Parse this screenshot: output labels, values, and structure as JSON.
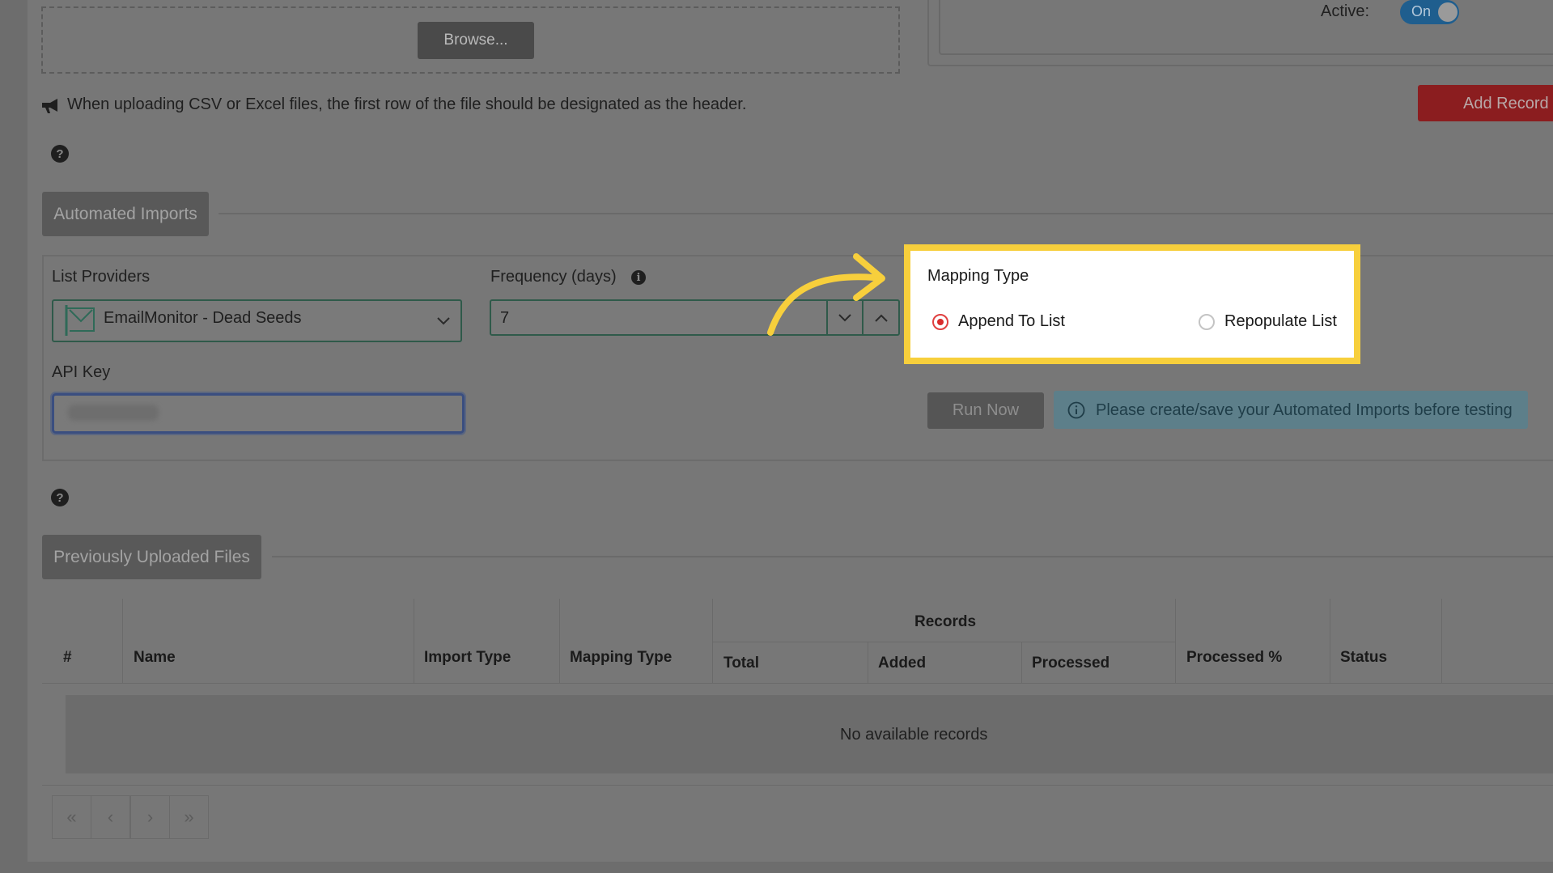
{
  "upload": {
    "browse_label": "Browse...",
    "notice": "When uploading CSV or Excel files, the first row of the file should be designated as the header."
  },
  "header": {
    "active_label": "Active:",
    "toggle_label": "On",
    "add_record_label": "Add Record"
  },
  "automated_imports": {
    "section_label": "Automated Imports",
    "list_providers_label": "List Providers",
    "list_provider_value": "EmailMonitor - Dead Seeds",
    "frequency_label": "Frequency (days)",
    "frequency_value": "7",
    "api_key_label": "API Key",
    "mapping_type_label": "Mapping Type",
    "mapping_options": [
      {
        "label": "Append To List",
        "selected": true
      },
      {
        "label": "Repopulate List",
        "selected": false
      }
    ],
    "run_now_label": "Run Now",
    "test_notice": "Please create/save your Automated Imports before testing"
  },
  "uploaded_files": {
    "section_label": "Previously Uploaded Files",
    "columns": {
      "num": "#",
      "name": "Name",
      "import_type": "Import Type",
      "mapping_type": "Mapping Type",
      "records": "Records",
      "total": "Total",
      "added": "Added",
      "processed": "Processed",
      "processed_pct": "Processed %",
      "status": "Status"
    },
    "empty_text": "No available records"
  },
  "pagination": {
    "first": "«",
    "prev": "‹",
    "next": "›",
    "last": "»"
  },
  "colors": {
    "highlight": "#f7cf3c",
    "radio_selected": "#d92b2b",
    "add_record": "#8b1d1f",
    "toggle": "#1f5e8e"
  }
}
